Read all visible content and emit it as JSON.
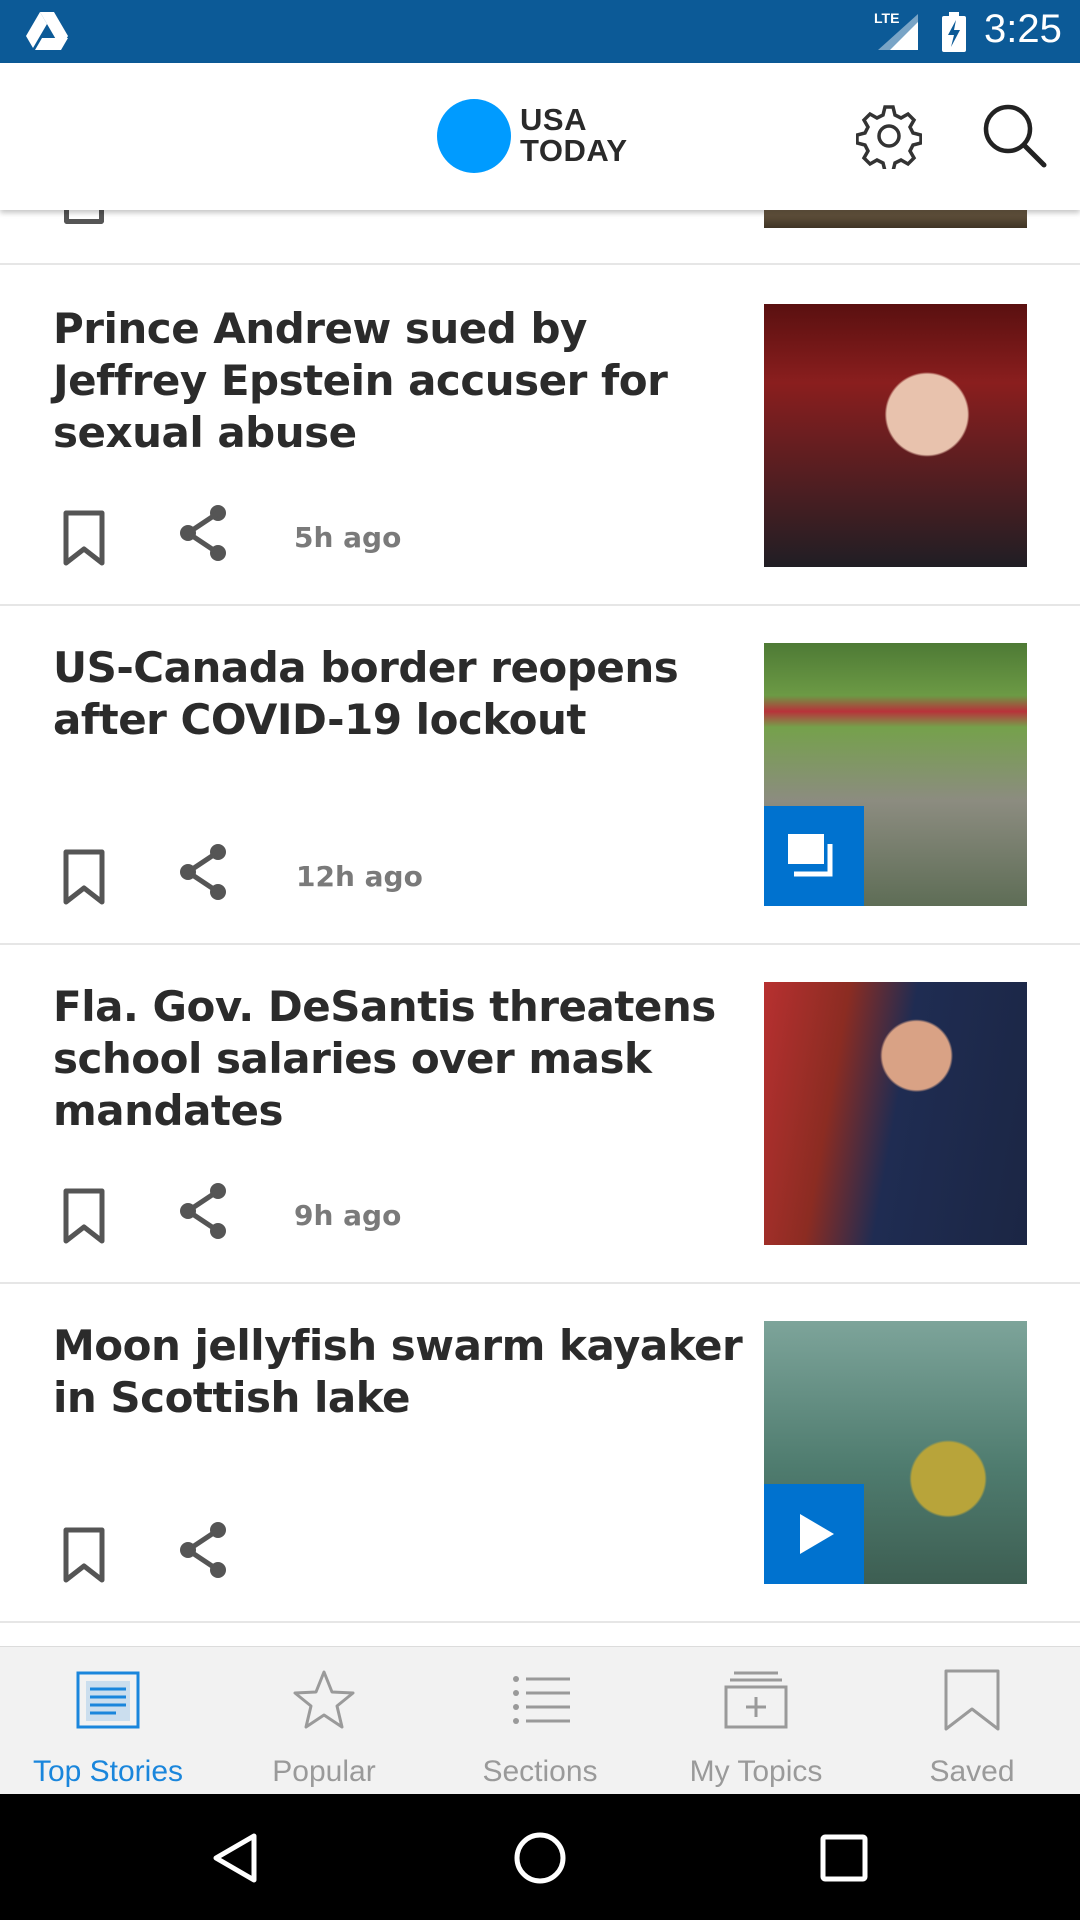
{
  "status_bar": {
    "network": "LTE",
    "time": "3:25",
    "icons": [
      "drive-icon",
      "signal-icon",
      "battery-charging-icon"
    ]
  },
  "header": {
    "logo_line1": "USA",
    "logo_line2": "TODAY",
    "brand_color": "#009bff",
    "icons": [
      "settings-gear-icon",
      "search-icon"
    ]
  },
  "stories": [
    {
      "headline": "Prince Andrew sued by Jeffrey Epstein accuser for sexual abuse",
      "age": "5h ago",
      "badge": null
    },
    {
      "headline": "US-Canada border reopens after COVID-19 lockout",
      "age": "12h ago",
      "badge": "gallery-icon"
    },
    {
      "headline": "Fla. Gov. DeSantis threatens school salaries over mask mandates",
      "age": "9h ago",
      "badge": null
    },
    {
      "headline": "Moon jellyfish swarm kayaker in Scottish lake",
      "age": "",
      "badge": "play-icon"
    }
  ],
  "bottom_nav": {
    "items": [
      {
        "label": "Top Stories",
        "icon": "top-stories-icon",
        "active": true
      },
      {
        "label": "Popular",
        "icon": "star-icon",
        "active": false
      },
      {
        "label": "Sections",
        "icon": "list-icon",
        "active": false
      },
      {
        "label": "My Topics",
        "icon": "add-topic-icon",
        "active": false
      },
      {
        "label": "Saved",
        "icon": "bookmark-icon",
        "active": false
      }
    ],
    "active_color": "#1a86dc",
    "inactive_color": "#9a9a9a"
  },
  "system_nav": {
    "icons": [
      "back-icon",
      "home-icon",
      "recents-icon"
    ]
  }
}
